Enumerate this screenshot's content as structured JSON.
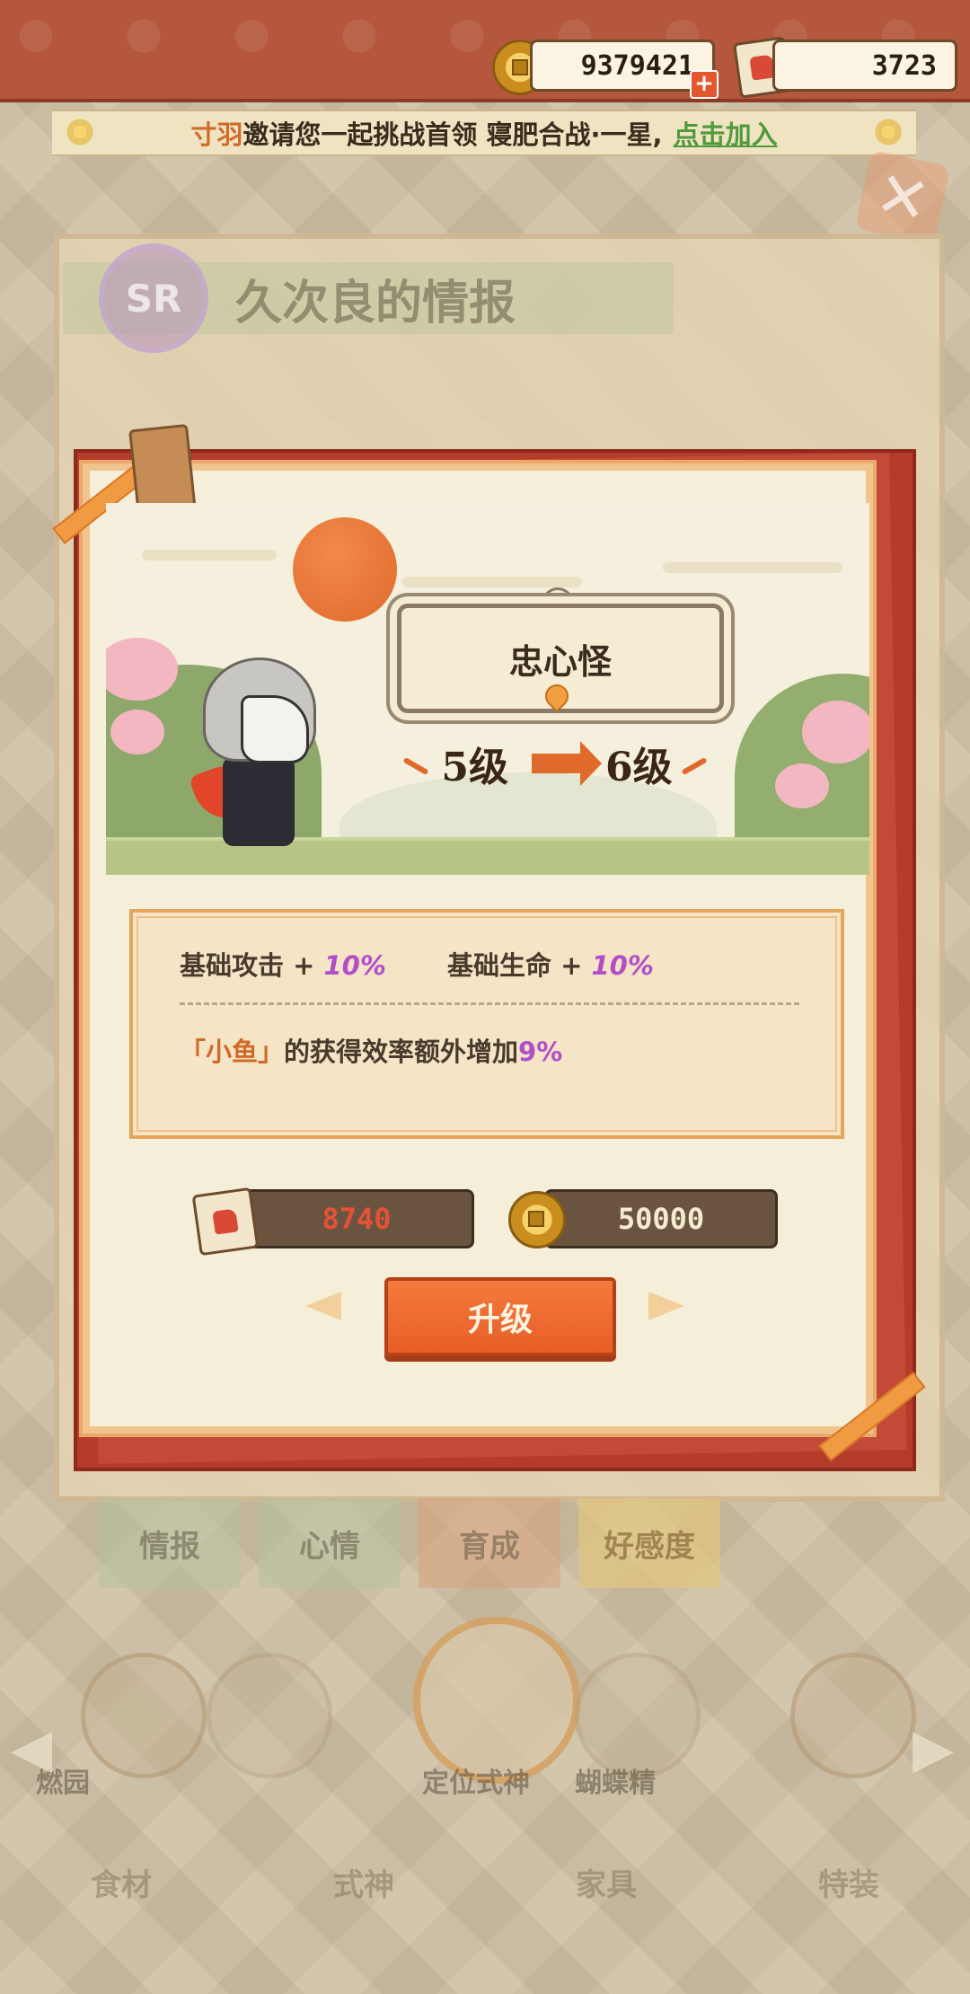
{
  "header": {
    "coins": "9379421",
    "likes": "3723"
  },
  "banner": {
    "inviter": "寸羽",
    "message": "邀请您一起挑战首领 寝肥合战·一星,",
    "join_label": "点击加入"
  },
  "background": {
    "rarity": "SR",
    "title": "久次良的情报",
    "tabs": [
      "情报",
      "心情",
      "育成",
      "好感度"
    ],
    "shiki_center_label": "定位式神",
    "shiki_left_label": "燃园",
    "shiki_right_label": "蝴蝶精",
    "bottom_nav": [
      "食材",
      "式神",
      "家具",
      "特装"
    ]
  },
  "modal": {
    "skill_name": "忠心怪",
    "level_from": "5级",
    "level_to": "6级",
    "stats": {
      "attack_label": "基础攻击 + ",
      "attack_value": "10%",
      "hp_label": "基础生命 + ",
      "hp_value": "10%"
    },
    "perk": {
      "name": "「小鱼」",
      "text": "的获得效率额外增加",
      "value": "9%"
    },
    "cost_likes": "8740",
    "cost_coins": "50000",
    "upgrade_label": "升级"
  },
  "colors": {
    "accent_orange": "#e85e26",
    "modal_red": "#b53c2b",
    "stat_purple": "#b04fc8",
    "join_green": "#4f9a3a",
    "cost_insufficient": "#e35236"
  }
}
